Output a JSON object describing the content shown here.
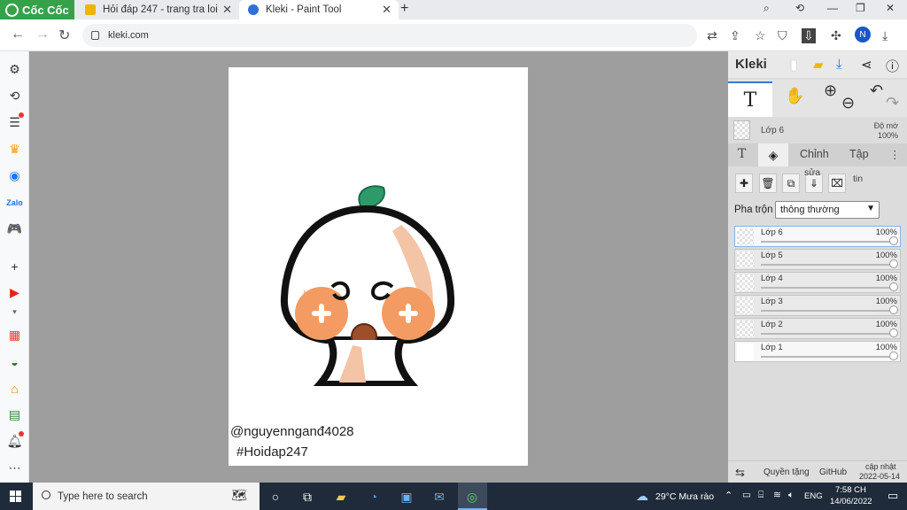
{
  "browser": {
    "brand": "Cốc Cốc",
    "tabs": [
      {
        "title": "Hỏi đáp 247 - trang tra loi",
        "icon": "hoidap-favicon"
      },
      {
        "title": "Kleki - Paint Tool",
        "icon": "kleki-favicon",
        "active": true
      }
    ],
    "url": "kleki.com",
    "profile_initial": "N"
  },
  "canvas": {
    "signature_line1": "@nguyennganđ4028",
    "signature_line2": "#Hoidap247"
  },
  "kleki": {
    "logo": "Kleki",
    "tool_text_glyph": "T",
    "active_layer": {
      "name": "Lớp 6",
      "opacity_label": "Độ mờ",
      "opacity": "100%"
    },
    "subtabs": {
      "text": "T",
      "edit": "Chỉnh",
      "file": "Tập",
      "edit_suffix": "sửa",
      "file_suffix": "tin"
    },
    "blend_label": "Pha trộn",
    "blend_value": "thông thường",
    "layers": [
      {
        "name": "Lớp 6",
        "opacity": "100%",
        "active": true
      },
      {
        "name": "Lớp 5",
        "opacity": "100%"
      },
      {
        "name": "Lớp 4",
        "opacity": "100%"
      },
      {
        "name": "Lớp 3",
        "opacity": "100%"
      },
      {
        "name": "Lớp 2",
        "opacity": "100%"
      },
      {
        "name": "Lớp 1",
        "opacity": "100%"
      }
    ],
    "footer": {
      "privacy": "Quyền tặng",
      "github": "GitHub",
      "updated_label": "cập nhật",
      "updated_date": "2022-05-14"
    }
  },
  "taskbar": {
    "search_placeholder": "Type here to search",
    "weather": "29°C  Mưa rào",
    "language": "ENG",
    "time": "7:58 CH",
    "date": "14/06/2022"
  }
}
